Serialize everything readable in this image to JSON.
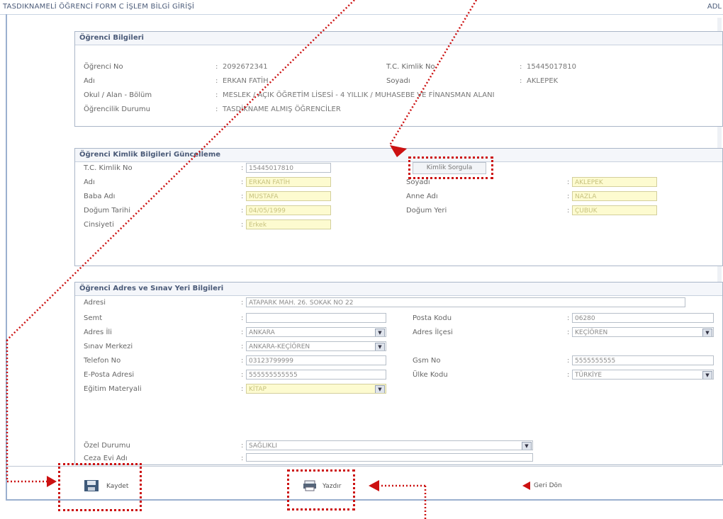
{
  "window": {
    "title_left": "TASDIKNAMELİ ÖĞRENCİ FORM C İŞLEM BİLGİ GİRİŞİ",
    "title_right": "ADL"
  },
  "student_info": {
    "header": "Öğrenci Bilgileri",
    "rows": [
      {
        "label": "Öğrenci No",
        "value": "2092672341"
      },
      {
        "label": "Adı",
        "value": "ERKAN FATİH"
      },
      {
        "label": "Okul / Alan - Bölüm",
        "value": "MESLEK / AÇIK ÖĞRETİM LİSESİ - 4 YILLIK / MUHASEBE VE FİNANSMAN ALANI"
      },
      {
        "label": "Öğrencilik Durumu",
        "value": "TASDİKNAME ALMIŞ ÖĞRENCİLER"
      }
    ],
    "tc_label": "T.C. Kimlik No",
    "tc_value": "15445017810",
    "soyadi_label": "Soyadı",
    "soyadi_value": "AKLEPEK"
  },
  "kimlik": {
    "header": "Öğrenci Kimlik Bilgileri Güncelleme",
    "tc_label": "T.C. Kimlik No",
    "tc_value": "15445017810",
    "adi_label": "Adı",
    "adi_value": "ERKAN FATİH",
    "baba_label": "Baba Adı",
    "baba_value": "MUSTAFA",
    "dogum_tarihi_label": "Doğum Tarihi",
    "dogum_tarihi_value": "04/05/1999",
    "cinsiyet_label": "Cinsiyeti",
    "cinsiyet_value": "Erkek",
    "soyadi_label": "Soyadı",
    "soyadi_value": "AKLEPEK",
    "anne_label": "Anne Adı",
    "anne_value": "NAZLA",
    "dogum_yeri_label": "Doğum Yeri",
    "dogum_yeri_value": "ÇUBUK",
    "sorgula_button": "Kimlik Sorgula"
  },
  "adres": {
    "header": "Öğrenci Adres ve Sınav Yeri Bilgileri",
    "adres_label": "Adresi",
    "adres_value": "ATAPARK MAH. 26. SOKAK NO 22",
    "semt_label": "Semt",
    "semt_value": "",
    "adres_il_label": "Adres İli",
    "adres_il_value": "ANKARA",
    "sinav_label": "Sınav Merkezi",
    "sinav_value": "ANKARA-KEÇİÖREN",
    "telefon_label": "Telefon No",
    "telefon_value": "03123799999",
    "eposta_label": "E-Posta Adresi",
    "eposta_value": "555555555555",
    "egitim_label": "Eğitim Materyali",
    "egitim_value": "KİTAP",
    "posta_label": "Posta Kodu",
    "posta_value": "06280",
    "ilce_label": "Adres İlçesi",
    "ilce_value": "KEÇİÖREN",
    "gsm_label": "Gsm No",
    "gsm_value": "5555555555",
    "ulke_label": "Ülke Kodu",
    "ulke_value": "TÜRKİYE",
    "ozel_label": "Özel Durumu",
    "ozel_value": "SAĞLIKLI",
    "ceza_label": "Ceza Evi Adı",
    "ceza_value": ""
  },
  "actions": {
    "kaydet": "Kaydet",
    "yazdir": "Yazdır",
    "geri_don": "Geri Dön"
  },
  "colors": {
    "annotation_red": "#cc1111",
    "field_yellow": "#fdfbd0",
    "frame_blue": "#9bb0cf"
  }
}
